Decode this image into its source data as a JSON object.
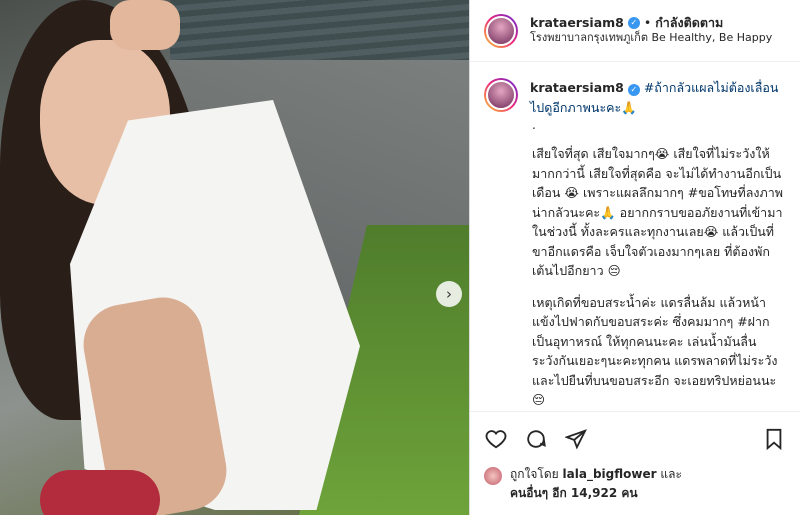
{
  "post": {
    "username": "krataersiam8",
    "follow_label": "กำลังติดตาม",
    "separator": "•",
    "location": "โรงพยาบาลกรุงเทพภูเก็ต Be Healthy, Be Happy",
    "photo_next_icon": "chevron-right-icon"
  },
  "caption": {
    "title_hashtag": "#ถ้ากลัวแผลไม่ต้องเลื่อนไปดูอีกภาพนะคะ",
    "title_emoji": "🙏",
    "dot": ".",
    "paragraphs": [
      "เสียใจที่สุด เสียใจมากๆ😭 เสียใจที่ไม่ระวังให้มากกว่านี้ เสียใจที่สุดคือ จะไม่ได้ทำงานอีกเป็นเดือน 😭 เพราะแผลลึกมากๆ #ขอโทษที่ลงภาพน่ากลัวนะคะ🙏 อยากกราบขออภัยงานที่เข้ามาในช่วงนี้ ทั้งละครและทุกงานเลย😭 แล้วเป็นที่ขาอีกแดรคือ เจ็บใจตัวเองมากๆเลย ที่ต้องพักเต้นไปอีกยาว 😔",
      "เหตุเกิดที่ขอบสระน้ำค่ะ แดรลื่นล้ม แล้วหน้าแข้งไปฟาดกับขอบสระค่ะ ซึ่งคมมากๆ #ฝากเป็นอุทาหรณ์ ให้ทุกคนนะคะ เล่นน้ำมันลื่น ระวังกันเยอะๆนะคะทุกคน แดรพลาดที่ไม่ระวัง และไปยืนที่บนขอบสระอีก จะเอยทริปหย่อนนะ😔"
    ]
  },
  "actions": {
    "like_icon": "heart-icon",
    "comment_icon": "comment-icon",
    "share_icon": "share-icon",
    "save_icon": "bookmark-icon"
  },
  "likes": {
    "prefix": "ถูกใจโดย",
    "user": "lala_bigflower",
    "and": "และ",
    "others": "คนอื่นๆ อีก 14,922 คน"
  },
  "colors": {
    "verified": "#3897f0",
    "hashtag": "#00376b",
    "border": "#dbdbdb"
  }
}
